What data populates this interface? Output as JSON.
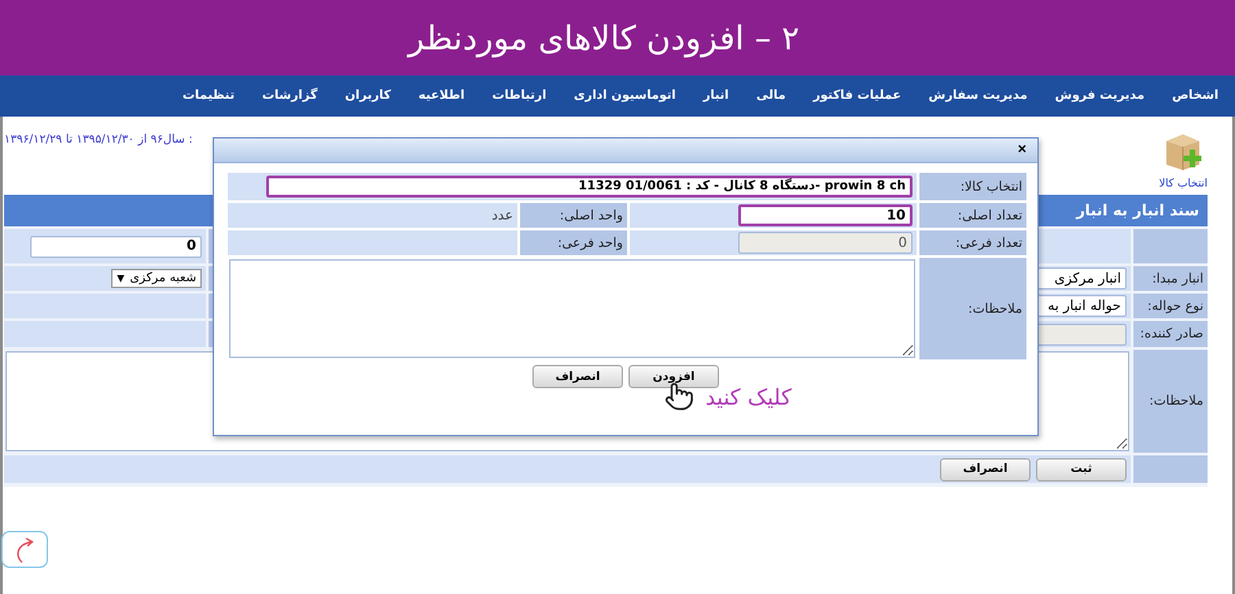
{
  "header": {
    "title": "۲ – افزودن کالاهای موردنظر"
  },
  "menu": [
    "اشخاص",
    "مدیریت فروش",
    "مدیریت سفارش",
    "عملیات فاکتور",
    "مالی",
    "انبار",
    "اتوماسیون اداری",
    "ارتباطات",
    "اطلاعیه",
    "کاربران",
    "گزارشات",
    "تنظیمات"
  ],
  "toolbar": {
    "add_item": "انتخاب کالا",
    "period": ": سال۹۶ از ۱۳۹۵/۱۲/۳۰ تا ۱۳۹۶/۱۲/۲۹"
  },
  "form": {
    "title": "سند انبار به انبار",
    "total": "0",
    "branch": {
      "value": "شعبه مرکزی",
      "caret": "▼"
    },
    "source": {
      "label": "انبار مبدا:",
      "value": "انبار مرکزی"
    },
    "transfer_type": {
      "label": "نوع حواله:",
      "value": "حواله انبار به"
    },
    "issuer": {
      "label": "صادر کننده:",
      "disabled": true
    },
    "notes": {
      "label": "ملاحظات:"
    },
    "buttons": [
      "ثبت",
      "انصراف"
    ]
  },
  "dialog": {
    "close": "×",
    "product": {
      "label": "انتخاب کالا:",
      "value": "prowin 8 ch -دستگاه 8 کانال - کد : 01/0061 11329",
      "highlighted": true
    },
    "quantity": {
      "label": "تعداد اصلی:",
      "value": "10",
      "highlighted": true
    },
    "unit": {
      "label": "واحد اصلی:",
      "value": "عدد"
    },
    "sub_quantity": {
      "label": "تعداد فرعی:",
      "value": "0",
      "disabled": true
    },
    "sub_unit": {
      "label": "واحد فرعی:"
    },
    "notes": {
      "label": "ملاحظات:"
    },
    "buttons": [
      "افزودن",
      "انصراف"
    ],
    "hint": "کلیک کنید"
  }
}
